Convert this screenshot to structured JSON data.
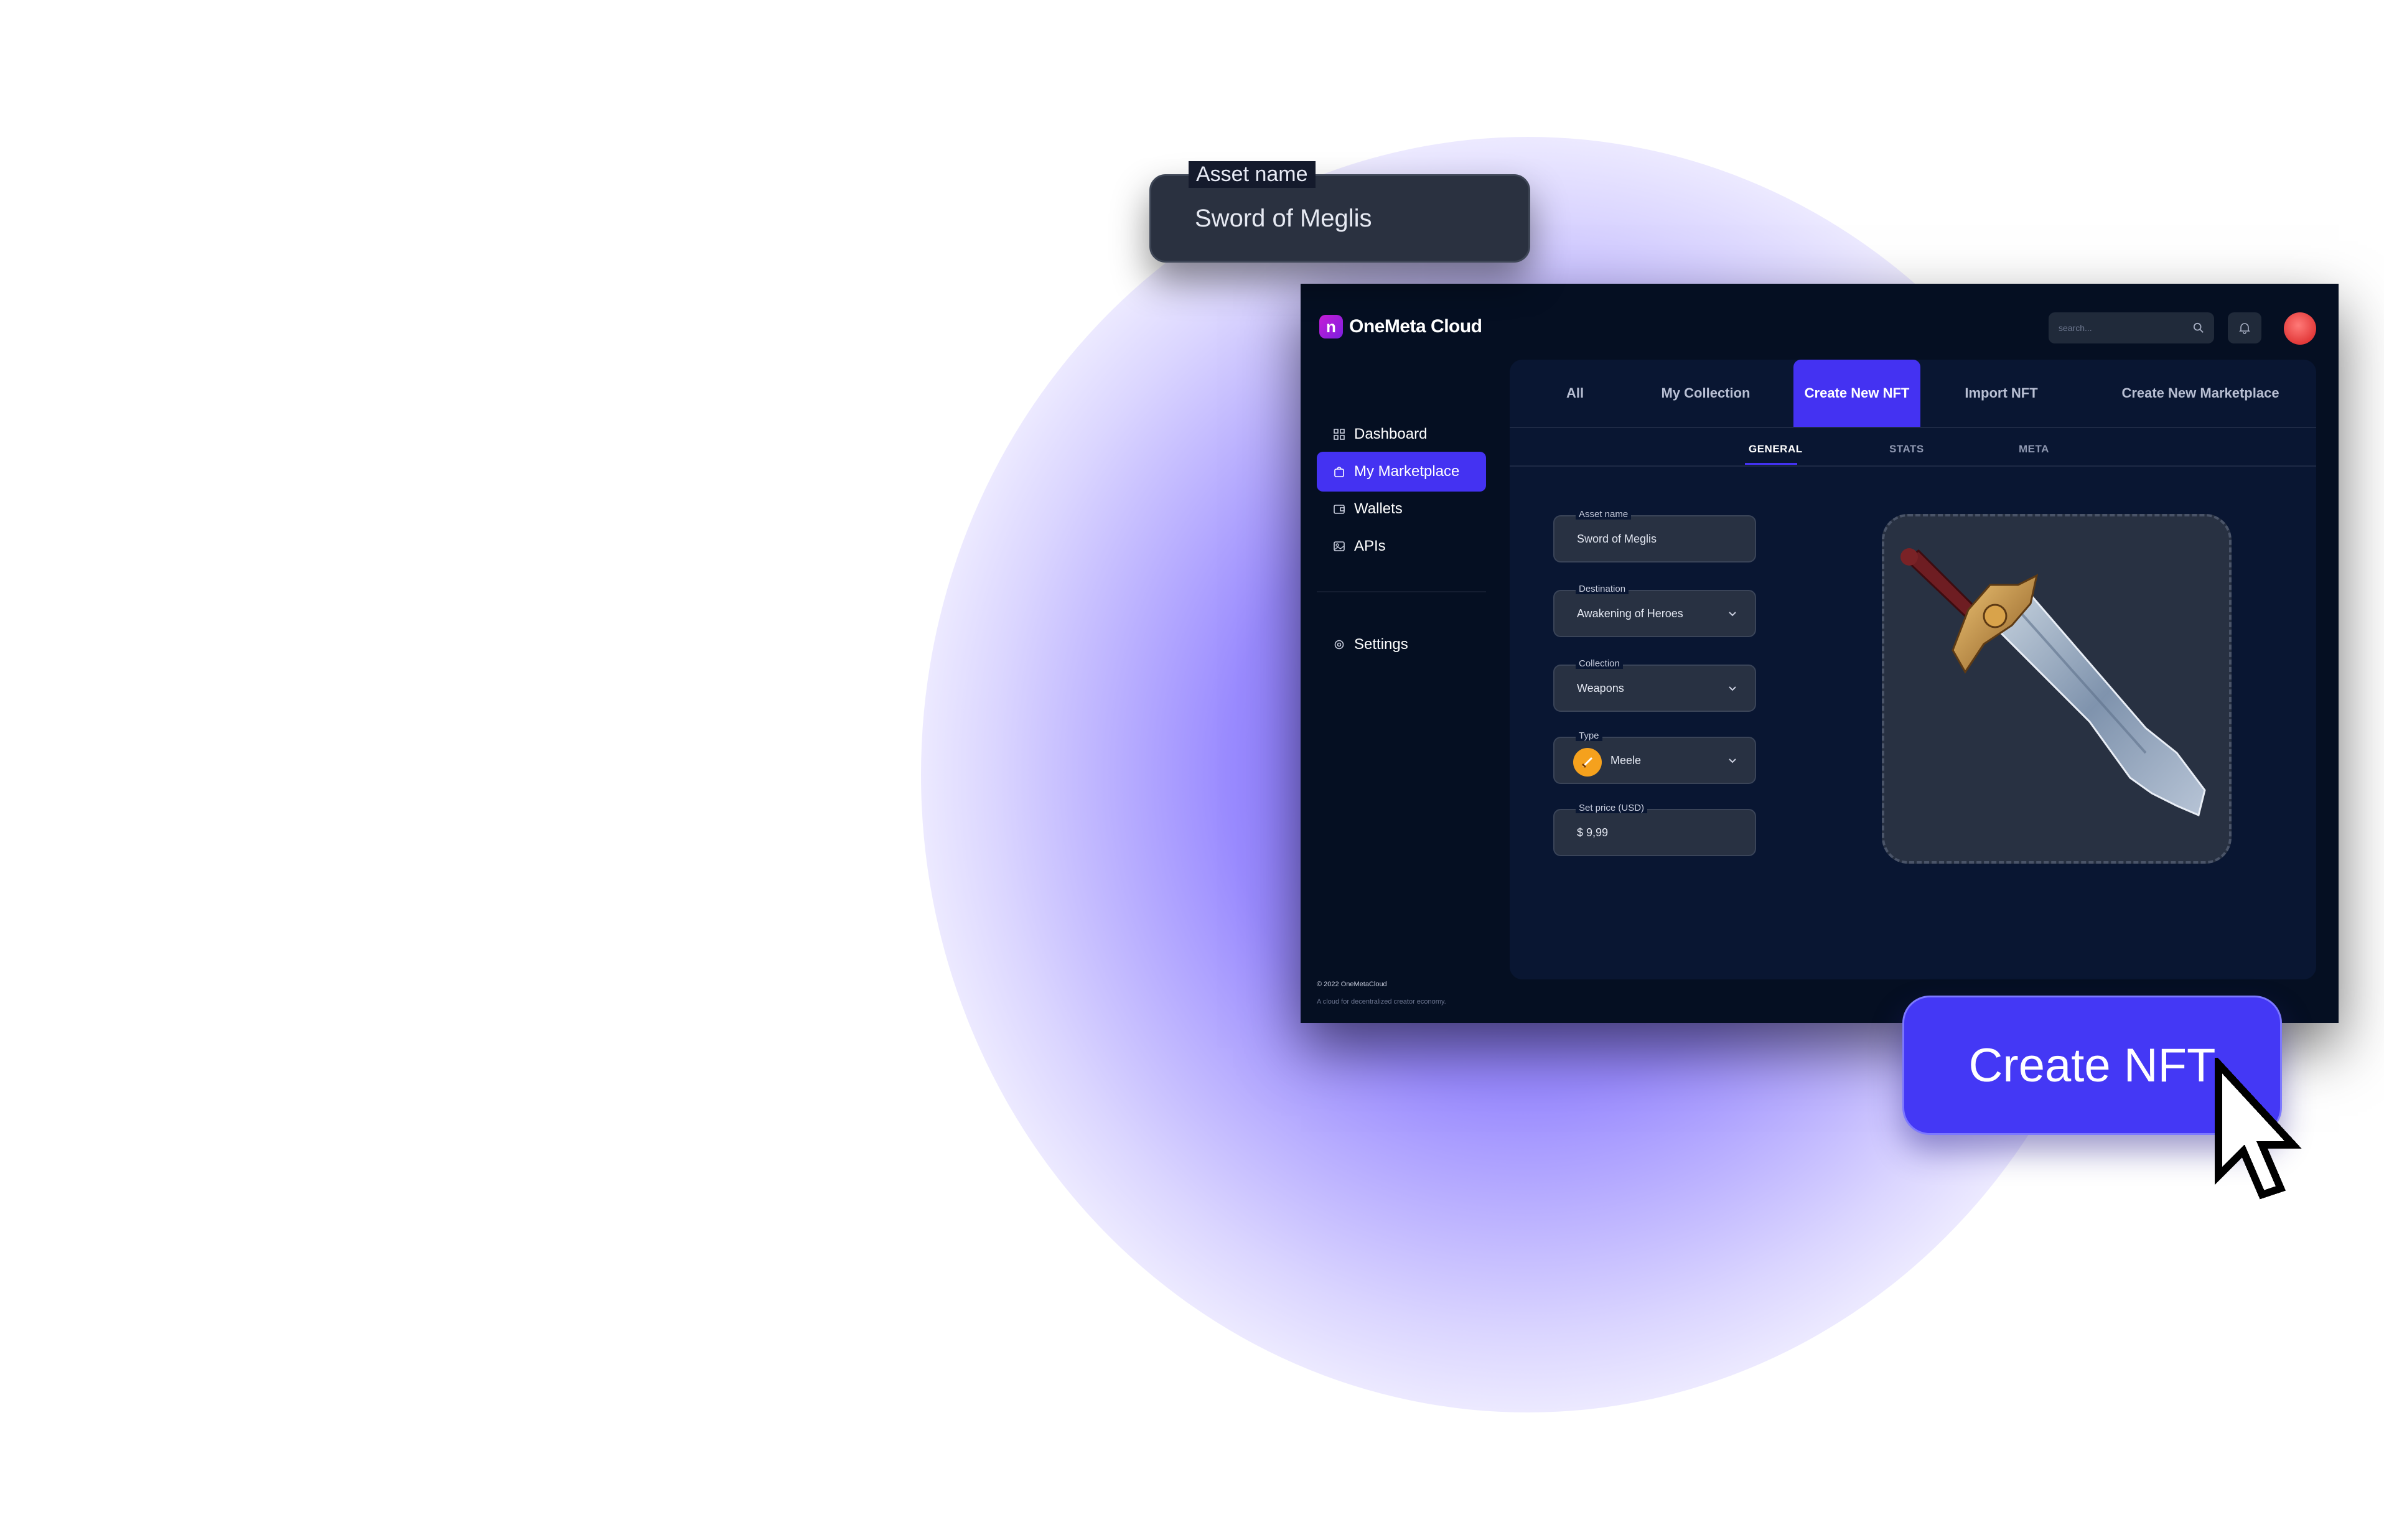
{
  "floating_card": {
    "label": "Asset name",
    "value": "Sword of Meglis"
  },
  "app": {
    "brand": "OneMeta Cloud",
    "search_placeholder": "search...",
    "sidebar": {
      "items": [
        {
          "label": "Dashboard",
          "icon": "grid-icon"
        },
        {
          "label": "My Marketplace",
          "icon": "shopping-bag-icon"
        },
        {
          "label": "Wallets",
          "icon": "wallet-icon"
        },
        {
          "label": "APIs",
          "icon": "api-icon"
        }
      ],
      "settings": "Settings",
      "footer_copyright": "© 2022 OneMetaCloud",
      "footer_tagline": "A cloud for decentralized creator economy."
    },
    "tabs": [
      "All",
      "My Collection",
      "Create New NFT",
      "Import NFT",
      "Create New Marketplace"
    ],
    "subtabs": [
      "GENERAL",
      "STATS",
      "META"
    ],
    "form": {
      "asset_name": {
        "label": "Asset name",
        "value": "Sword of Meglis"
      },
      "destination": {
        "label": "Destination",
        "value": "Awakening of Heroes"
      },
      "collection": {
        "label": "Collection",
        "value": "Weapons"
      },
      "type": {
        "label": "Type",
        "value": "Meele"
      },
      "price": {
        "label": "Set price (USD)",
        "value": "$ 9,99"
      }
    }
  },
  "create_button": "Create NFT",
  "colors": {
    "accent": "#4432f2",
    "app_bg": "#050f22",
    "panel_bg": "#091632",
    "field_bg": "#283142",
    "type_badge": "#f5a11d",
    "avatar": "#e33a3a"
  }
}
